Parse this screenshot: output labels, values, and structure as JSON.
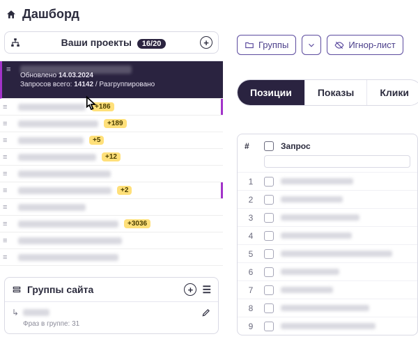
{
  "header": {
    "title": "Дашборд"
  },
  "projects_bar": {
    "label": "Ваши проекты",
    "count": "16/20"
  },
  "active_project": {
    "updated_label": "Обновлено",
    "updated_date": "14.03.2024",
    "total_label": "Запросов всего:",
    "total_value": "14142",
    "sep": "/",
    "grouped_label": "Разгруппировано"
  },
  "projects": [
    {
      "badge": "+186",
      "accent": true
    },
    {
      "badge": "+189"
    },
    {
      "badge": "+5"
    },
    {
      "badge": "+12"
    },
    {
      "badge": ""
    },
    {
      "badge": "+2",
      "accent": true
    },
    {
      "badge": ""
    },
    {
      "badge": "+3036"
    },
    {
      "badge": ""
    },
    {
      "badge": ""
    }
  ],
  "groups_card": {
    "title": "Группы сайта",
    "phrase_label": "Фраз в группе:",
    "phrase_count": "31"
  },
  "right_buttons": {
    "groups": "Группы",
    "ignore": "Игнор-лист"
  },
  "tabs": [
    "Позиции",
    "Показы",
    "Клики"
  ],
  "table": {
    "num_header": "#",
    "query_header": "Запрос",
    "rows": [
      1,
      2,
      3,
      4,
      5,
      6,
      7,
      8,
      9
    ]
  }
}
